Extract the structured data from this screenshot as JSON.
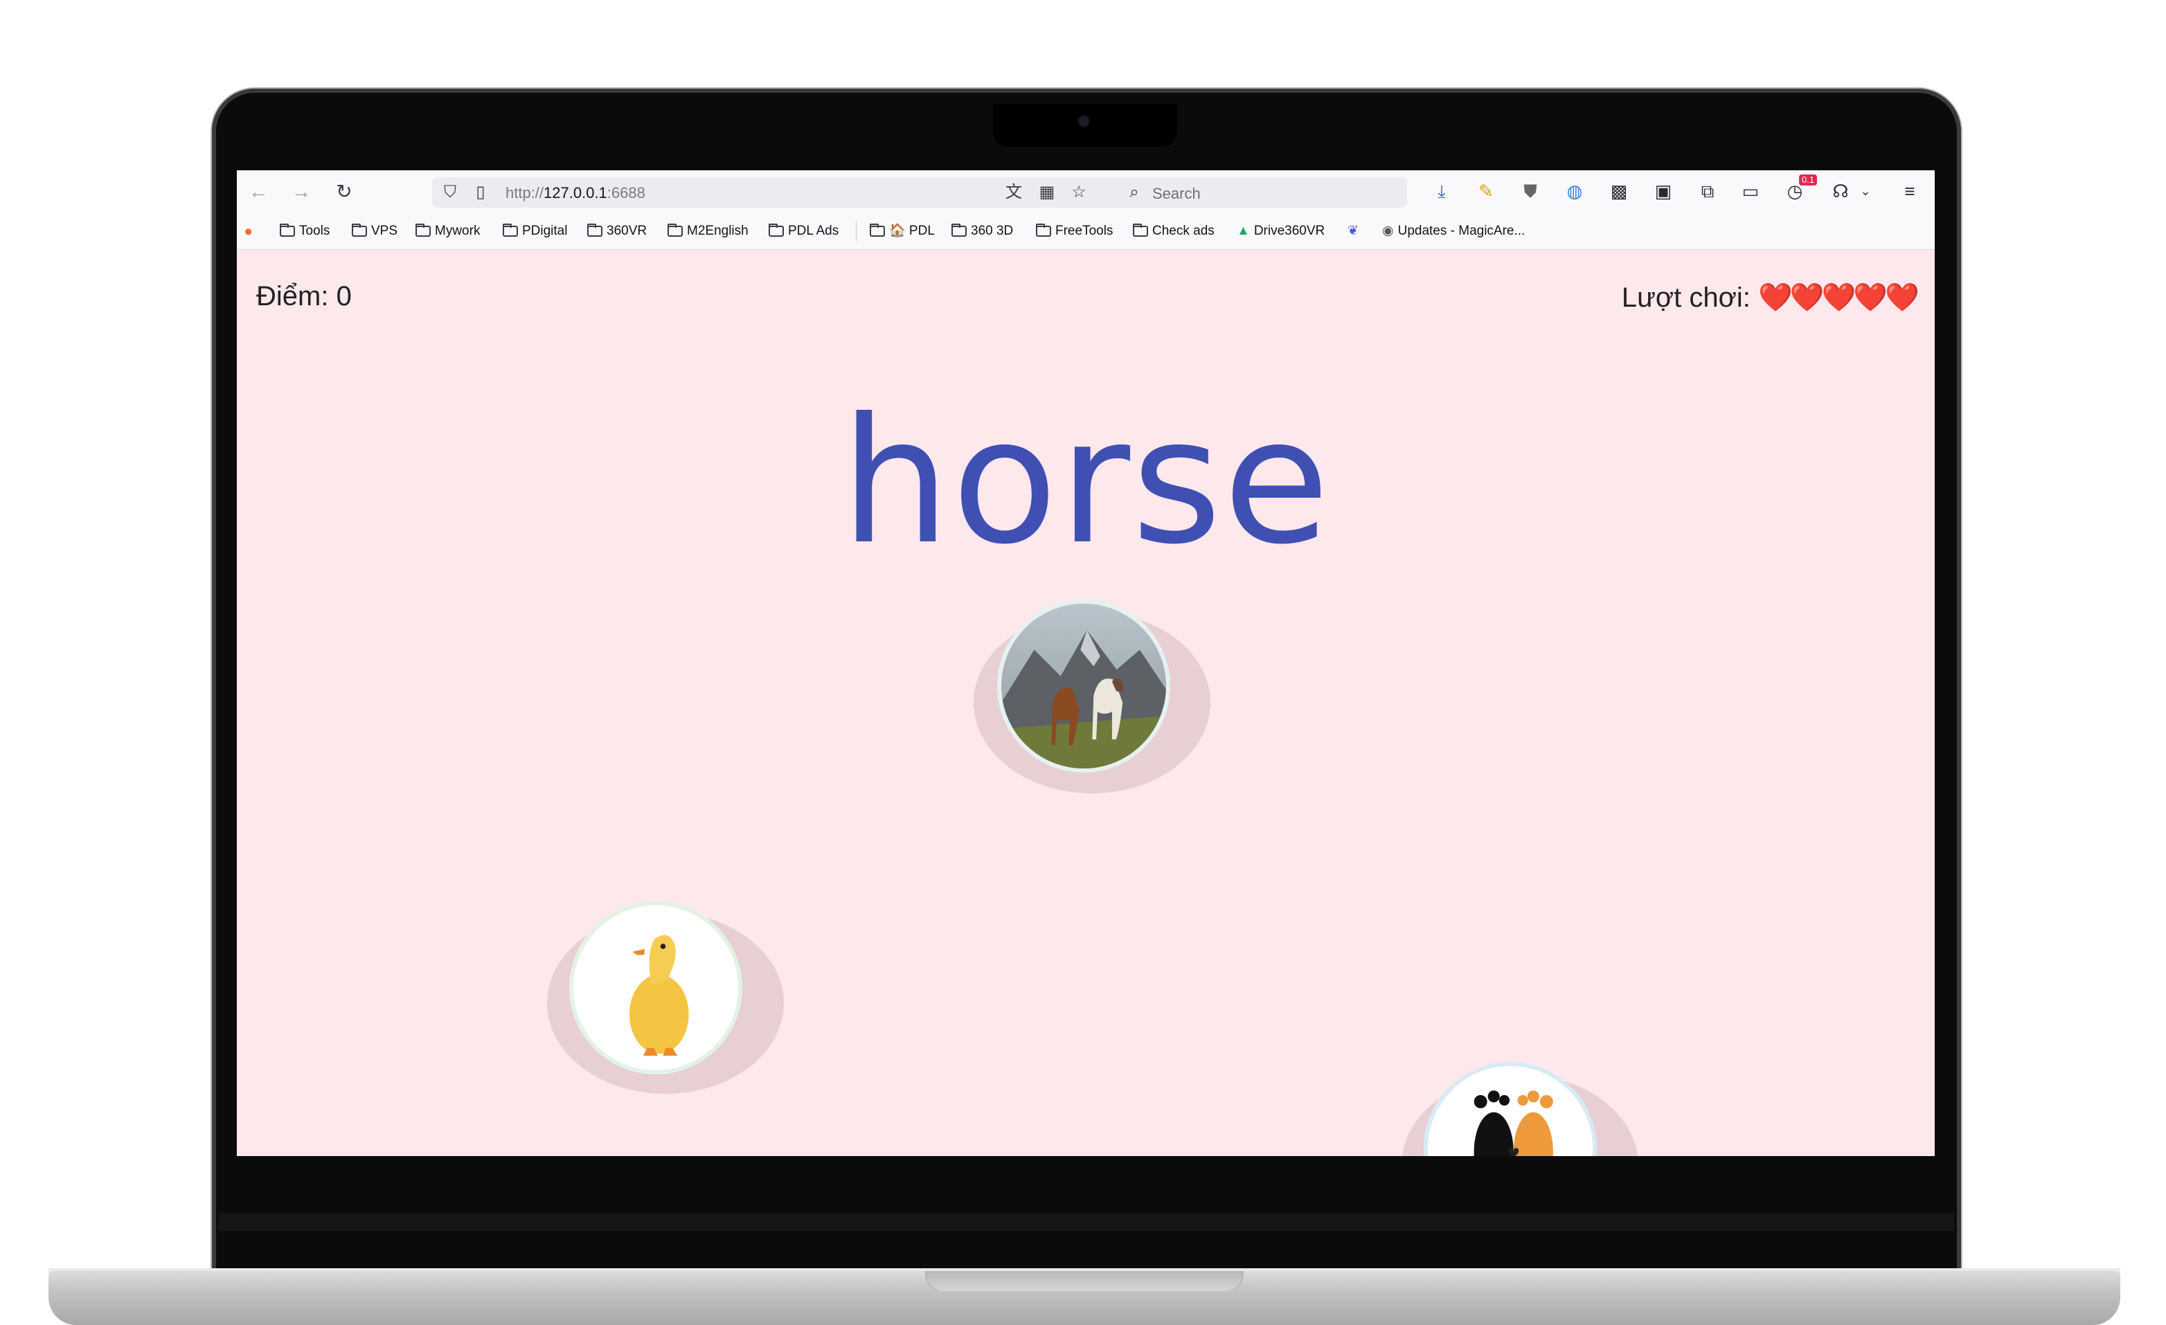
{
  "browser": {
    "url_prefix": "http://",
    "url_host": "127.0.0.1",
    "url_port": ":6688",
    "search_placeholder": "Search",
    "extension_badge": "0.1"
  },
  "bookmarks": [
    {
      "label": "Tools"
    },
    {
      "label": "VPS"
    },
    {
      "label": "Mywork"
    },
    {
      "label": "PDigital"
    },
    {
      "label": "360VR"
    },
    {
      "label": "M2English"
    },
    {
      "label": "PDL Ads"
    },
    {
      "label": "🏠 PDL"
    },
    {
      "label": "360 3D"
    },
    {
      "label": "FreeTools"
    },
    {
      "label": "Check ads"
    },
    {
      "label": "Drive360VR"
    },
    {
      "label": "Updates - MagicAre..."
    }
  ],
  "game": {
    "score_label": "Điểm: 0",
    "lives_label": "Lượt chơi:",
    "hearts": "❤️❤️❤️❤️❤️",
    "target_word": "horse",
    "options": [
      {
        "name": "horses"
      },
      {
        "name": "duckling"
      },
      {
        "name": "feet"
      }
    ]
  },
  "colors": {
    "page_bg": "#fde8ec",
    "word_color": "#3f4fb2",
    "bubble_shadow": "#e8cfd3"
  }
}
